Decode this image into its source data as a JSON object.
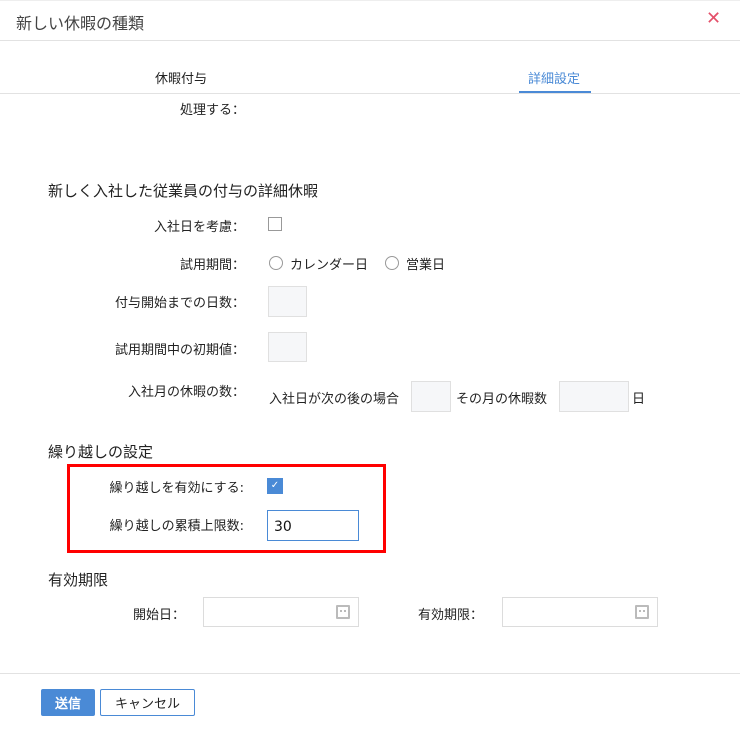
{
  "dialog": {
    "title": "新しい休暇の種類",
    "close_icon": "close-icon"
  },
  "tabs": [
    {
      "label": "休暇付与",
      "active": false
    },
    {
      "label": "詳細設定",
      "active": true
    }
  ],
  "process_label": "処理する：",
  "new_employee": {
    "heading": "新しく入社した従業員の付与の詳細休暇",
    "consider_join_date_label": "入社日を考慮：",
    "consider_join_date_checked": false,
    "probation_label": "試用期間：",
    "probation_options": [
      "カレンダー日",
      "営業日"
    ],
    "days_until_grant_label": "付与開始までの日数：",
    "days_until_grant_value": "",
    "probation_initial_label": "試用期間中の初期値：",
    "probation_initial_value": "",
    "join_month_label": "入社月の休暇の数：",
    "join_after_text": "入社日が次の後の場合",
    "month_leave_text": "その月の休暇数",
    "day_unit": "日"
  },
  "carryover": {
    "heading": "繰り越しの設定",
    "enable_label": "繰り越しを有効にする:",
    "enable_checked": true,
    "limit_label": "繰り越しの累積上限数:",
    "limit_value": "30"
  },
  "validity": {
    "heading": "有効期限",
    "start_label": "開始日：",
    "end_label": "有効期限：",
    "start_value": "",
    "end_value": ""
  },
  "footer": {
    "submit_label": "送信",
    "cancel_label": "キャンセル"
  },
  "colors": {
    "accent": "#4a8ad6",
    "close": "#e4506a",
    "highlight": "#ff0000"
  }
}
